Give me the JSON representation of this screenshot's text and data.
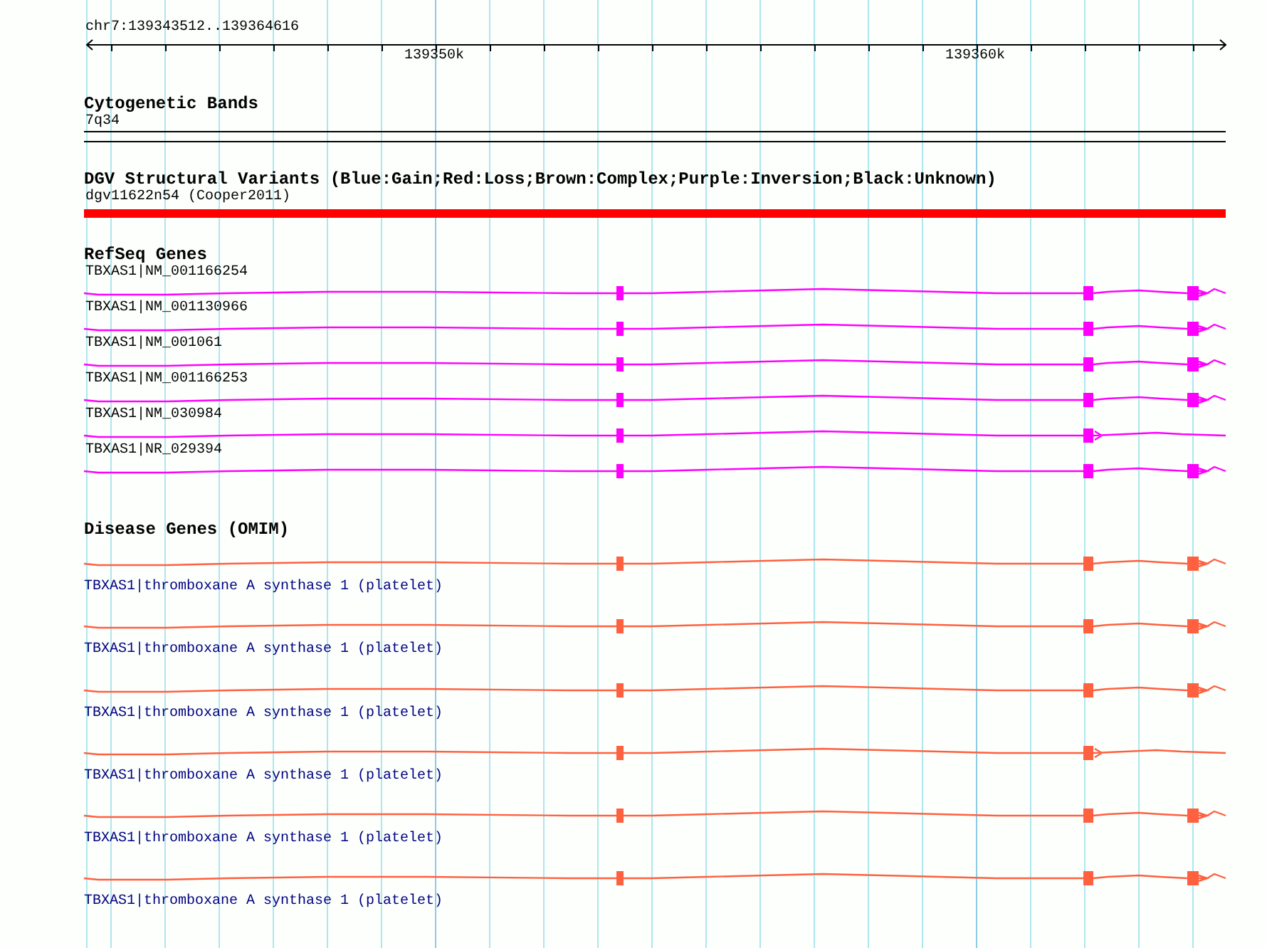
{
  "ruler": {
    "location": "chr7:139343512..139364616",
    "ticks": [
      "139350k",
      "139360k"
    ]
  },
  "tracks": [
    {
      "kind": "bands",
      "title": "Cytogenetic Bands",
      "features": [
        {
          "label": "7q34"
        }
      ]
    },
    {
      "kind": "variants",
      "title": "DGV Structural Variants (Blue:Gain;Red:Loss;Brown:Complex;Purple:Inversion;Black:Unknown)",
      "color": "#ff0000",
      "features": [
        {
          "label": "dgv11622n54 (Cooper2011)"
        }
      ]
    },
    {
      "kind": "genes",
      "title": "RefSeq Genes",
      "color": "#ff00ff",
      "features": [
        {
          "label": "TBXAS1|NM_001166254",
          "kind": "long"
        },
        {
          "label": "TBXAS1|NM_001130966",
          "kind": "long"
        },
        {
          "label": "TBXAS1|NM_001061",
          "kind": "long"
        },
        {
          "label": "TBXAS1|NM_001166253",
          "kind": "long"
        },
        {
          "label": "TBXAS1|NM_030984",
          "kind": "short"
        },
        {
          "label": "TBXAS1|NR_029394",
          "kind": "long"
        }
      ]
    },
    {
      "kind": "disease",
      "title": "Disease Genes (OMIM)",
      "color": "#ff6040",
      "features": [
        {
          "label": "TBXAS1|thromboxane A synthase 1 (platelet)",
          "kind": "long"
        },
        {
          "label": "TBXAS1|thromboxane A synthase 1 (platelet)",
          "kind": "long"
        },
        {
          "label": "TBXAS1|thromboxane A synthase 1 (platelet)",
          "kind": "long"
        },
        {
          "label": "TBXAS1|thromboxane A synthase 1 (platelet)",
          "kind": "short"
        },
        {
          "label": "TBXAS1|thromboxane A synthase 1 (platelet)",
          "kind": "long"
        },
        {
          "label": "TBXAS1|thromboxane A synthase 1 (platelet)",
          "kind": "long"
        }
      ]
    }
  ]
}
